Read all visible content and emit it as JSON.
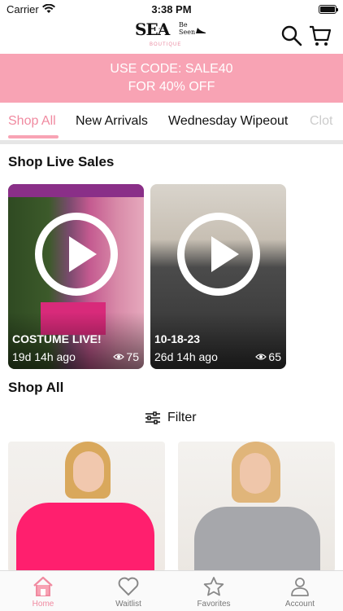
{
  "status": {
    "carrier": "Carrier",
    "time": "3:38 PM"
  },
  "logo": {
    "part1": "SEA",
    "part2": "and",
    "part3a": "Be",
    "part3b": "Seen",
    "part4": "BOUTIQUE"
  },
  "promo": {
    "line1": "USE CODE: SALE40",
    "line2": "FOR 40% OFF"
  },
  "tabs": [
    "Shop All",
    "New Arrivals",
    "Wednesday Wipeout",
    "Clot"
  ],
  "live_section_title": "Shop Live Sales",
  "live_sales": [
    {
      "title": "COSTUME LIVE!",
      "time": "19d 14h ago",
      "views": "75"
    },
    {
      "title": "10-18-23",
      "time": "26d 14h ago",
      "views": "65"
    }
  ],
  "shop_all_title": "Shop All",
  "filter_label": "Filter",
  "nav": [
    {
      "label": "Home",
      "icon": "home-icon"
    },
    {
      "label": "Waitlist",
      "icon": "heart-icon"
    },
    {
      "label": "Favorites",
      "icon": "star-icon"
    },
    {
      "label": "Account",
      "icon": "person-icon"
    }
  ],
  "colors": {
    "accent": "#f8a3b4",
    "accent_text": "#f08aa0"
  }
}
